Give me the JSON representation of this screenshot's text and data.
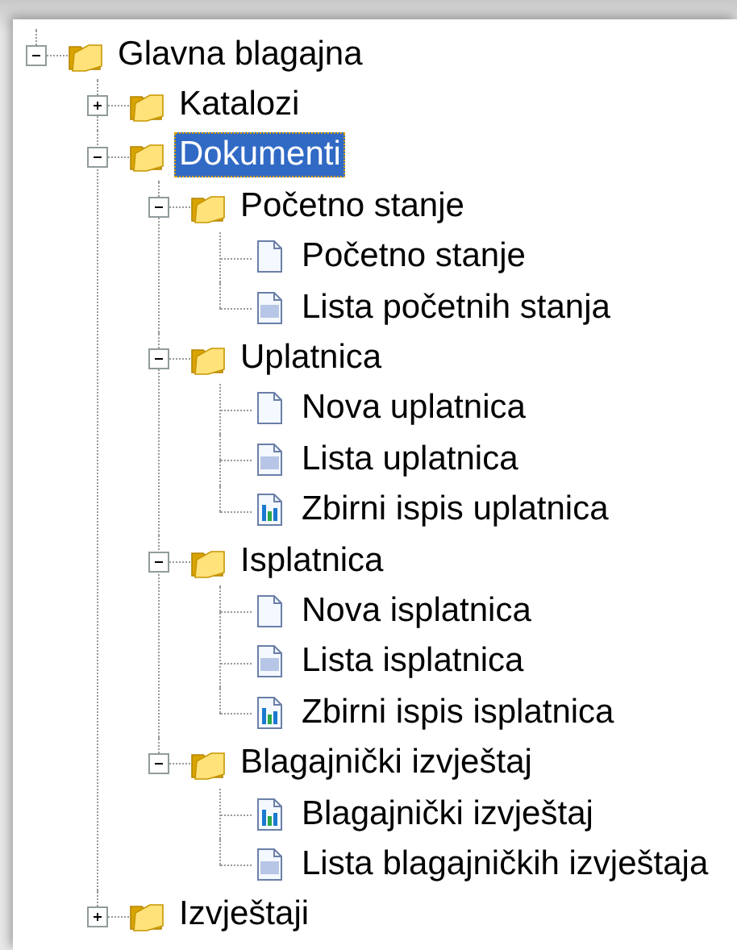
{
  "tree": [
    {
      "label": "Glavna blagajna",
      "kind": "folder",
      "expanded": true,
      "selected": false,
      "children": [
        {
          "label": "Katalozi",
          "kind": "folder",
          "expanded": false,
          "selected": false
        },
        {
          "label": "Dokumenti",
          "kind": "folder",
          "expanded": true,
          "selected": true,
          "children": [
            {
              "label": "Početno stanje",
              "kind": "folder",
              "expanded": true,
              "selected": false,
              "children": [
                {
                  "label": "Početno stanje",
                  "kind": "document",
                  "selected": false
                },
                {
                  "label": "Lista početnih stanja",
                  "kind": "list",
                  "selected": false
                }
              ]
            },
            {
              "label": "Uplatnica",
              "kind": "folder",
              "expanded": true,
              "selected": false,
              "children": [
                {
                  "label": "Nova uplatnica",
                  "kind": "document",
                  "selected": false
                },
                {
                  "label": "Lista uplatnica",
                  "kind": "list",
                  "selected": false
                },
                {
                  "label": "Zbirni ispis uplatnica",
                  "kind": "report",
                  "selected": false
                }
              ]
            },
            {
              "label": "Isplatnica",
              "kind": "folder",
              "expanded": true,
              "selected": false,
              "children": [
                {
                  "label": "Nova isplatnica",
                  "kind": "document",
                  "selected": false
                },
                {
                  "label": "Lista isplatnica",
                  "kind": "list",
                  "selected": false
                },
                {
                  "label": "Zbirni ispis isplatnica",
                  "kind": "report",
                  "selected": false
                }
              ]
            },
            {
              "label": "Blagajnički izvještaj",
              "kind": "folder",
              "expanded": true,
              "selected": false,
              "children": [
                {
                  "label": "Blagajnički izvještaj",
                  "kind": "report",
                  "selected": false
                },
                {
                  "label": "Lista blagajničkih izvještaja",
                  "kind": "list",
                  "selected": false
                }
              ]
            }
          ]
        },
        {
          "label": "Izvještaji",
          "kind": "folder",
          "expanded": false,
          "selected": false
        }
      ]
    }
  ]
}
